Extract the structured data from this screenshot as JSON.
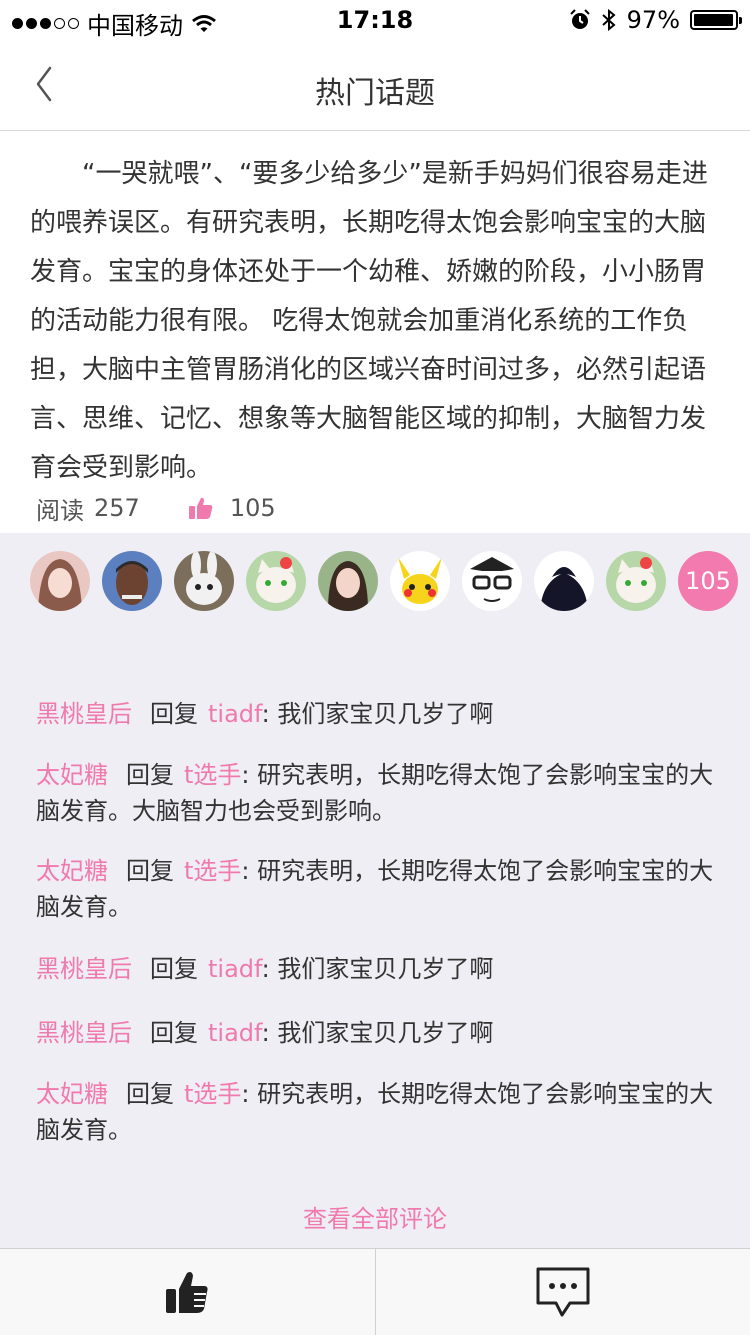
{
  "status_bar": {
    "carrier": "中国移动",
    "time": "17:18",
    "battery_pct": "97%",
    "battery_level": 0.97,
    "signal_filled": 3,
    "signal_total": 5
  },
  "nav": {
    "title": "热门话题"
  },
  "article": {
    "body": "“一哭就喂”、“要多少给多少”是新手妈妈们很容易走进的喂养误区。有研究表明，长期吃得太饱会影响宝宝的大脑发育。宝宝的身体还处于一个幼稚、娇嫩的阶段，小小肠胃的活动能力很有限。 吃得太饱就会加重消化系统的工作负担，大脑中主管胃肠消化的区域兴奋时间过多，必然引起语言、思维、记忆、想象等大脑智能区域的抑制，大脑智力发育会受到影响。"
  },
  "stats": {
    "read_label": "阅读",
    "read_count": "257",
    "like_count": "105"
  },
  "avatars": {
    "count_badge": "105"
  },
  "comments": [
    {
      "user": "黑桃皇后",
      "reply_label": "回复",
      "target": "tiadf",
      "text": ": 我们家宝贝几岁了啊"
    },
    {
      "user": "太妃糖",
      "reply_label": "回复",
      "target": "t选手",
      "text": ": 研究表明，长期吃得太饱了会影响宝宝的大脑发育。大脑智力也会受到影响。"
    },
    {
      "user": "太妃糖",
      "reply_label": "回复",
      "target": "t选手",
      "text": ": 研究表明，长期吃得太饱了会影响宝宝的大脑发育。"
    },
    {
      "user": "黑桃皇后",
      "reply_label": "回复",
      "target": "tiadf",
      "text": ": 我们家宝贝几岁了啊"
    },
    {
      "user": "黑桃皇后",
      "reply_label": "回复",
      "target": "tiadf",
      "text": ": 我们家宝贝几岁了啊"
    },
    {
      "user": "太妃糖",
      "reply_label": "回复",
      "target": "t选手",
      "text": ": 研究表明，长期吃得太饱了会影响宝宝的大脑发育。"
    }
  ],
  "view_all_label": "查看全部评论",
  "colors": {
    "accent": "#f07aad",
    "panel_bg": "#efeef4",
    "text": "#333333"
  }
}
